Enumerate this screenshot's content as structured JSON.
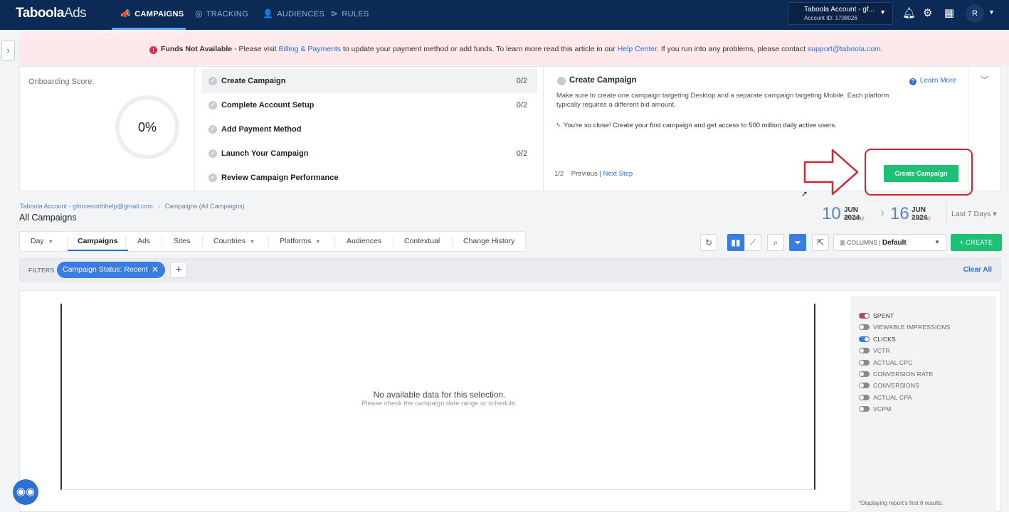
{
  "nav": {
    "logo_main": "Taboola",
    "logo_sub": "Ads",
    "tabs": [
      {
        "label": "CAMPAIGNS",
        "icon": "megaphone-icon"
      },
      {
        "label": "TRACKING",
        "icon": "tracking-icon"
      },
      {
        "label": "AUDIENCES",
        "icon": "person-icon"
      },
      {
        "label": "RULES",
        "icon": "rules-icon"
      }
    ],
    "account_name": "Taboola Account - gf...",
    "account_id": "Account ID: 1708026",
    "avatar_initial": "R"
  },
  "banner": {
    "title": "Funds Not Available",
    "text1": " - Please visit ",
    "link1": "Billing & Payments",
    "text2": " to update your payment method or add funds. To learn more read this article in our ",
    "link2": "Help Center",
    "text3": ". If you run into any problems, please contact ",
    "link3": "support@taboola.com",
    "text4": "."
  },
  "onboarding": {
    "score_label": "Onboarding Score:",
    "score_value": "0%",
    "steps": [
      {
        "label": "Create Campaign",
        "count": "0/2"
      },
      {
        "label": "Complete Account Setup",
        "count": "0/2"
      },
      {
        "label": "Add Payment Method",
        "count": ""
      },
      {
        "label": "Launch Your Campaign",
        "count": "0/2"
      },
      {
        "label": "Review Campaign Performance",
        "count": ""
      }
    ],
    "detail_title": "Create Campaign",
    "learn_more": "Learn More",
    "detail_desc": "Make sure to create one campaign targeting Desktop and a separate campaign targeting Mobile. Each platform typically requires a different bid amount.",
    "detail_close": "You're so close! Create your first campaign and get access to 500 million daily active users.",
    "pager_count": "1/2",
    "pager_prev": "Previous",
    "pager_next": "Next Step",
    "create_button": "Create Campaign"
  },
  "breadcrumb": {
    "account": "Taboola Account - gforcenorthhelp@gmail.com",
    "current": "Campaigns (All Campaigns)"
  },
  "page_title": "All Campaigns",
  "dates": {
    "start_day": "10",
    "start_month": "JUN 2024",
    "start_weekday": "Monday",
    "end_day": "16",
    "end_month": "JUN 2024",
    "end_weekday": "Sunday",
    "range": "Last 7 Days"
  },
  "tabs": [
    "Day",
    "Campaigns",
    "Ads",
    "Sites",
    "Countries",
    "Platforms",
    "Audiences",
    "Contextual",
    "Change History"
  ],
  "toolbar": {
    "columns_label": "COLUMNS",
    "columns_value": "Default",
    "create": "+ CREATE"
  },
  "filters": {
    "label": "FILTERS",
    "chip": "Campaign Status: Recent",
    "add": "+",
    "clear": "Clear All"
  },
  "chart": {
    "nodata": "No available data for this selection.",
    "nodata_hint": "Please check the campaign date range or schedule."
  },
  "metrics": [
    {
      "label": "SPENT",
      "on": true,
      "color": "#b04a6a"
    },
    {
      "label": "VIEWABLE IMPRESSIONS",
      "on": false,
      "color": "#8a8a8a"
    },
    {
      "label": "CLICKS",
      "on": true,
      "color": "#3a7de0"
    },
    {
      "label": "VCTR",
      "on": false,
      "color": "#8a8a8a"
    },
    {
      "label": "ACTUAL CPC",
      "on": false,
      "color": "#8a8a8a"
    },
    {
      "label": "CONVERSION RATE",
      "on": false,
      "color": "#8a8a8a"
    },
    {
      "label": "CONVERSIONS",
      "on": false,
      "color": "#8a8a8a"
    },
    {
      "label": "ACTUAL CPA",
      "on": false,
      "color": "#8a8a8a"
    },
    {
      "label": "VCPM",
      "on": false,
      "color": "#8a8a8a"
    }
  ],
  "metrics_note": "*Displaying report's first 8 results.",
  "colors": {
    "nav_bg": "#0b2a55",
    "accent_blue": "#3a7de0",
    "accent_green": "#1fbf75",
    "alert_red": "#d6334a",
    "highlight_red": "#d8222f"
  }
}
